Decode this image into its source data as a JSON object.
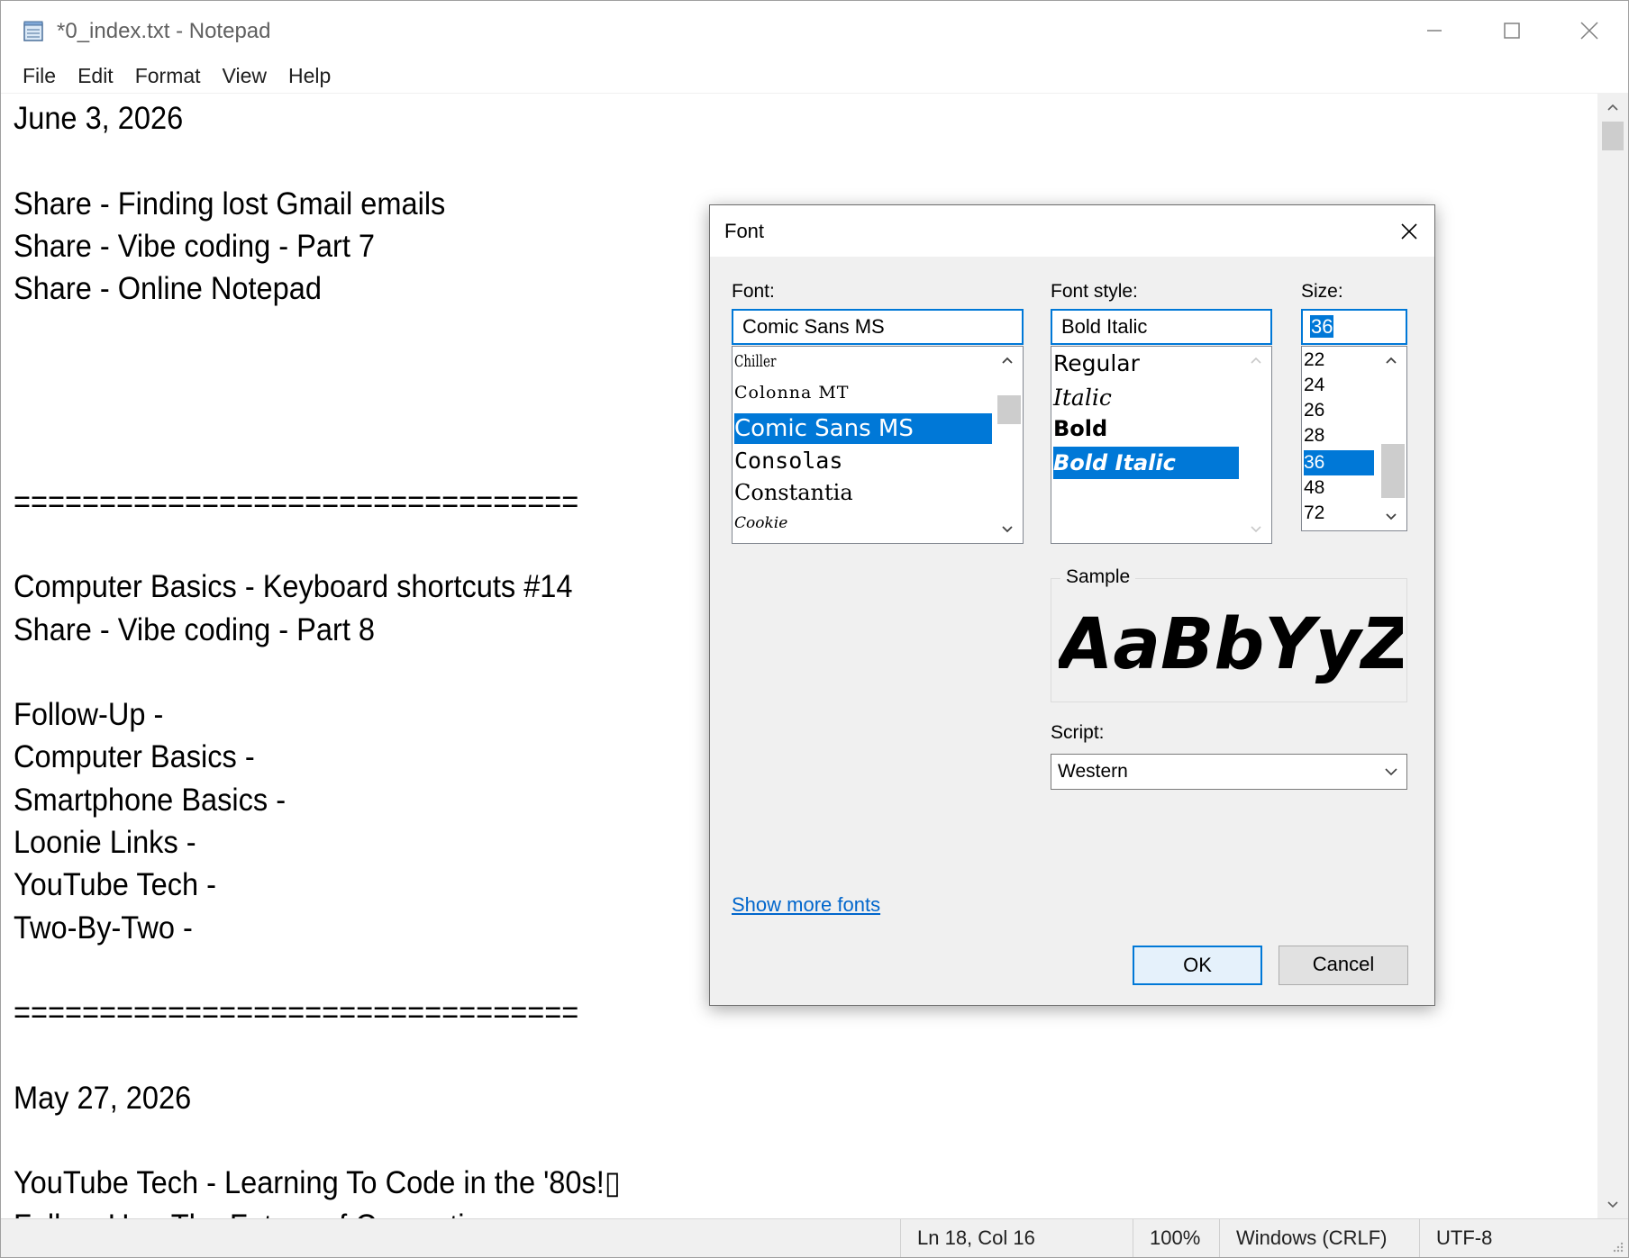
{
  "window": {
    "title": "*0_index.txt - Notepad"
  },
  "menu": {
    "items": [
      "File",
      "Edit",
      "Format",
      "View",
      "Help"
    ]
  },
  "editor": {
    "lines": [
      "June 3, 2026",
      "",
      "Share - Finding lost Gmail emails",
      "Share - Vibe coding - Part 7",
      "Share - Online Notepad",
      "",
      "",
      "",
      "",
      "=================================",
      "",
      "Computer Basics - Keyboard shortcuts #14",
      "Share - Vibe coding - Part 8",
      "",
      "Follow-Up -",
      "Computer Basics -",
      "Smartphone Basics -",
      "Loonie Links -",
      "YouTube Tech -",
      "Two-By-Two -",
      "",
      "=================================",
      "",
      "May 27, 2026",
      "",
      "YouTube Tech - Learning To Code in the '80s!▯",
      "Follow-Up - The Future of Computing"
    ]
  },
  "status": {
    "position": "Ln 18, Col 16",
    "zoom": "100%",
    "line_ending": "Windows (CRLF)",
    "encoding": "UTF-8"
  },
  "font_dialog": {
    "title": "Font",
    "font_label": "Font:",
    "font_value": "Comic Sans MS",
    "font_list": [
      "Chiller",
      "Colonna MT",
      "Comic Sans MS",
      "Consolas",
      "Constantia",
      "Cookie"
    ],
    "font_selected": "Comic Sans MS",
    "style_label": "Font style:",
    "style_value": "Bold Italic",
    "style_list": [
      "Regular",
      "Italic",
      "Bold",
      "Bold Italic"
    ],
    "style_selected": "Bold Italic",
    "size_label": "Size:",
    "size_value": "36",
    "size_list": [
      "22",
      "24",
      "26",
      "28",
      "36",
      "48",
      "72"
    ],
    "size_selected": "36",
    "sample_label": "Sample",
    "sample_text": "AaBbYyZz",
    "script_label": "Script:",
    "script_value": "Western",
    "show_more_fonts": "Show more fonts",
    "ok_label": "OK",
    "cancel_label": "Cancel"
  },
  "colors": {
    "selection": "#0078d7",
    "link": "#0066cc"
  }
}
